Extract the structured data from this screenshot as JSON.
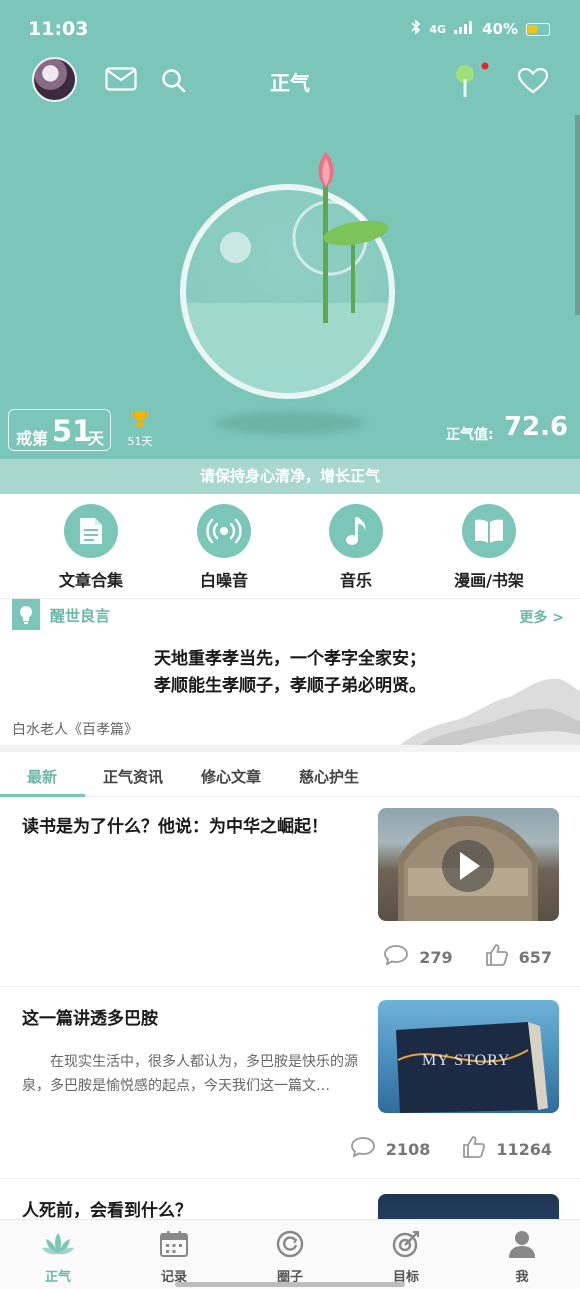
{
  "status_bar": {
    "time": "11:03",
    "network": "4G",
    "battery": "40%"
  },
  "header": {
    "title": "正气",
    "icons": [
      "avatar",
      "mail-icon",
      "search-icon",
      "tree-icon",
      "heart-icon"
    ]
  },
  "hero": {
    "days_prefix": "戒第",
    "days_number": "51",
    "days_suffix": "天",
    "trophy_label": "51天",
    "zhengqi_label": "正气值:",
    "zhengqi_value": "72.6",
    "keep_message": "请保持身心清净，增长正气"
  },
  "quick_entries": [
    {
      "label": "文章合集",
      "icon": "document-icon"
    },
    {
      "label": "白噪音",
      "icon": "broadcast-icon"
    },
    {
      "label": "音乐",
      "icon": "music-note-icon"
    },
    {
      "label": "漫画/书架",
      "icon": "book-icon"
    }
  ],
  "quote": {
    "section_title": "醒世良言",
    "more": "更多 >",
    "line1": "天地重孝孝当先，一个孝字全家安；",
    "line2": "孝顺能生孝顺子，孝顺子弟必明贤。",
    "author": "白水老人《百孝篇》"
  },
  "tabs": [
    "最新",
    "正气资讯",
    "修心文章",
    "慈心护生"
  ],
  "articles": [
    {
      "title": "读书是为了什么？他说：为中华之崛起！",
      "description": "",
      "thumb_text": "",
      "comments": "279",
      "likes": "657"
    },
    {
      "title": "这一篇讲透多巴胺",
      "description": "在现实生活中，很多人都认为，多巴胺是快乐的源泉，多巴胺是愉悦感的起点，今天我们这一篇文…",
      "thumb_text": "MY STORY",
      "comments": "2108",
      "likes": "11264"
    },
    {
      "title": "人死前，会看到什么？",
      "description": "",
      "thumb_text": "",
      "comments": "",
      "likes": ""
    }
  ],
  "bottom_nav": [
    {
      "label": "正气",
      "icon": "lotus-icon"
    },
    {
      "label": "记录",
      "icon": "calendar-icon"
    },
    {
      "label": "圈子",
      "icon": "circle-refresh-icon"
    },
    {
      "label": "目标",
      "icon": "target-icon"
    },
    {
      "label": "我",
      "icon": "person-icon"
    }
  ],
  "colors": {
    "accent": "#7cc6b9",
    "accent_text": "#6cb7aa",
    "keep_bar": "#a7d7cf"
  }
}
